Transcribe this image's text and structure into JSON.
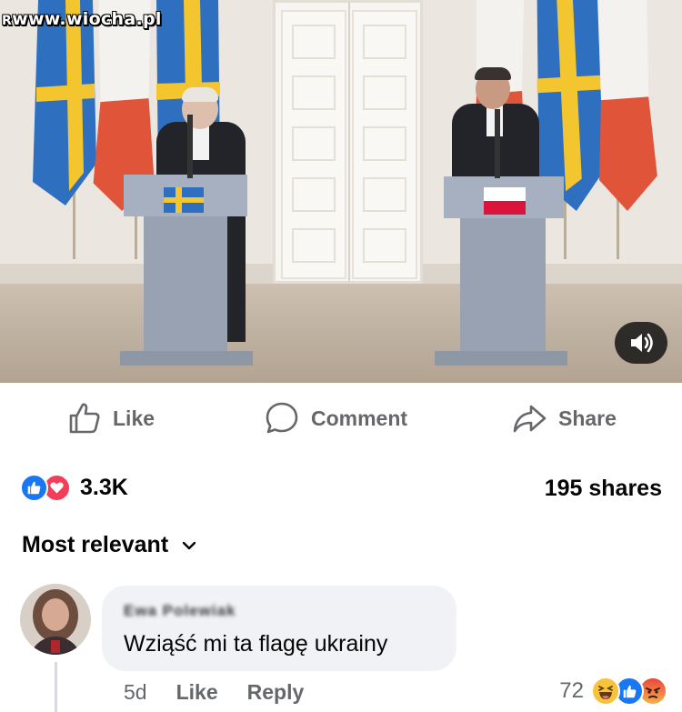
{
  "watermark": {
    "prefix": "R",
    "text": "www.wiocha.pl"
  },
  "video": {
    "audio_icon": "speaker-icon"
  },
  "actions": {
    "like_label": "Like",
    "comment_label": "Comment",
    "share_label": "Share"
  },
  "stats": {
    "reaction_count": "3.3K",
    "reactions": [
      "like-reaction-icon",
      "love-reaction-icon"
    ],
    "shares": "195 shares"
  },
  "sort": {
    "label": "Most relevant"
  },
  "comment": {
    "author": "Ewa Polewiak",
    "text": "Wziąść mi ta flagę ukrainy",
    "time": "5d",
    "like_label": "Like",
    "reply_label": "Reply",
    "reaction_count": "72",
    "reactions": [
      "haha-reaction-icon",
      "like-reaction-icon",
      "angry-reaction-icon"
    ]
  },
  "colors": {
    "accent": "#1877f2",
    "love": "#f33e58",
    "muted_text": "#65676b",
    "bubble": "#f0f2f5",
    "sweden_blue": "#2e6fc0",
    "sweden_yellow": "#f3c62f",
    "poland_red": "#e0453a"
  }
}
